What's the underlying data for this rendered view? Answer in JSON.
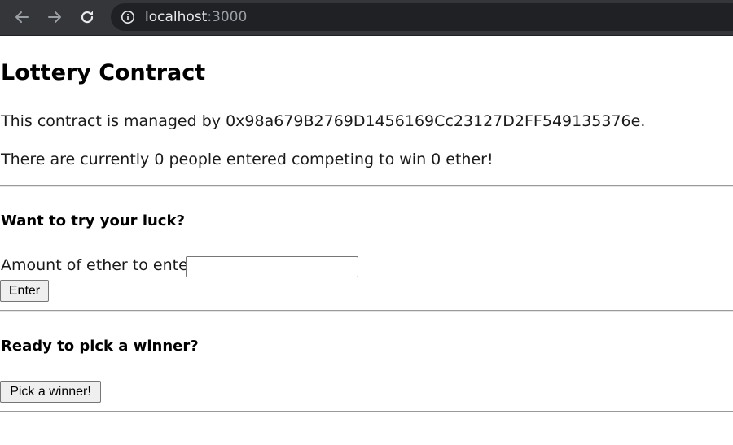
{
  "browser": {
    "url_host": "localhost",
    "url_port": ":3000",
    "icons": {
      "back": "arrow-back-icon",
      "forward": "arrow-forward-icon",
      "reload": "reload-icon",
      "info": "info-icon"
    }
  },
  "page": {
    "title": "Lottery Contract",
    "manager_text": "This contract is managed by 0x98a679B2769D1456169Cc23127D2FF549135376e.",
    "status_text": "There are currently 0 people entered competing to win 0 ether!",
    "enter_section": {
      "heading": "Want to try your luck?",
      "amount_label": "Amount of ether to enter",
      "amount_value": "",
      "enter_button": "Enter"
    },
    "winner_section": {
      "heading": "Ready to pick a winner?",
      "pick_button": "Pick a winner!"
    }
  },
  "colors": {
    "toolbar_bg": "#35363a",
    "omnibox_bg": "#202124",
    "url_host": "#e8eaed",
    "url_port": "#9aa0a6"
  }
}
